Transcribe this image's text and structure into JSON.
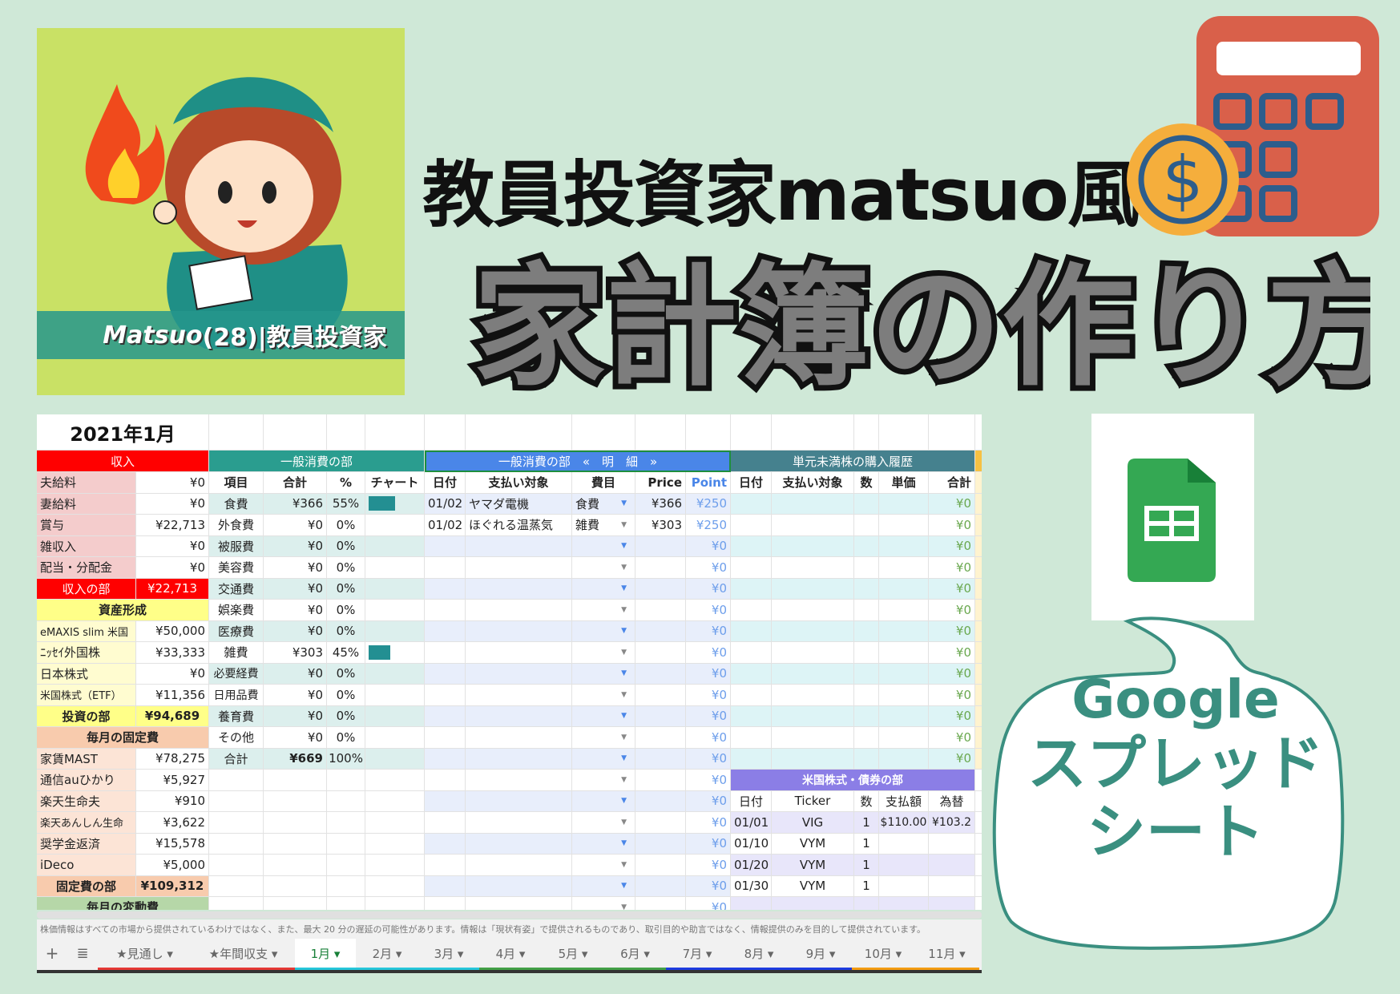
{
  "avatar": {
    "name_latin": "Matsuo",
    "name_rest": "(28)|教員投資家"
  },
  "title_line1": "教員投資家matsuo風",
  "title_line2": "家計簿の作り方",
  "bubble": {
    "line1": "Google",
    "line2": "スプレッド",
    "line3": "シート"
  },
  "icons": {
    "calculator": "calculator-icon",
    "coin": "dollar-coin-icon",
    "sheets": "google-sheets-icon",
    "flame": "flame-icon"
  },
  "colors": {
    "background": "#cfe8d7",
    "income": "#ff0000",
    "general": "#2a9d8f",
    "detail": "#4a86e8",
    "oddlot": "#45818e",
    "us": "#8b7ee6",
    "bubble_text": "#3a8f80"
  },
  "sheet": {
    "month_title": "2021年1月",
    "headers": {
      "income": "収入",
      "general": "一般消費の部",
      "detail": "一般消費の部　«　明　細　»",
      "oddlot": "単元未満株の購入履歴"
    },
    "left_rows": [
      {
        "label": "夫給料",
        "value": "¥0",
        "kind": "income"
      },
      {
        "label": "妻給料",
        "value": "¥0",
        "kind": "income"
      },
      {
        "label": "賞与",
        "value": "¥22,713",
        "kind": "income"
      },
      {
        "label": "雑収入",
        "value": "¥0",
        "kind": "income"
      },
      {
        "label": "配当・分配金",
        "value": "¥0",
        "kind": "income"
      },
      {
        "label": "収入の部",
        "value": "¥22,713",
        "kind": "income_total"
      },
      {
        "label": "資産形成",
        "kind": "asset_section"
      },
      {
        "label": "eMAXIS slim 米国",
        "value": "¥50,000",
        "kind": "asset"
      },
      {
        "label": "ﾆｯｾｲ外国株",
        "value": "¥33,333",
        "kind": "asset"
      },
      {
        "label": "日本株式",
        "value": "¥0",
        "kind": "asset"
      },
      {
        "label": "米国株式（ETF）",
        "value": "¥11,356",
        "kind": "asset"
      },
      {
        "label": "投資の部",
        "value": "¥94,689",
        "kind": "asset_total"
      },
      {
        "label": "毎月の固定費",
        "kind": "fixed_section"
      },
      {
        "label": "家賃MAST",
        "value": "¥78,275",
        "kind": "fixed"
      },
      {
        "label": "通信auひかり",
        "value": "¥5,927",
        "kind": "fixed"
      },
      {
        "label": "楽天生命夫",
        "value": "¥910",
        "kind": "fixed"
      },
      {
        "label": "楽天あんしん生命",
        "value": "¥3,622",
        "kind": "fixed"
      },
      {
        "label": "奨学金返済",
        "value": "¥15,578",
        "kind": "fixed"
      },
      {
        "label": "iDeco",
        "value": "¥5,000",
        "kind": "fixed"
      },
      {
        "label": "固定費の部",
        "value": "¥109,312",
        "kind": "fixed_total"
      },
      {
        "label": "毎月の変動費",
        "kind": "variable_section"
      }
    ],
    "general": {
      "columns": [
        "項目",
        "合計",
        "%",
        "チャート"
      ],
      "items": [
        {
          "name": "食費",
          "total": "¥366",
          "pct": "55%",
          "share": 55
        },
        {
          "name": "外食費",
          "total": "¥0",
          "pct": "0%",
          "share": 0
        },
        {
          "name": "被服費",
          "total": "¥0",
          "pct": "0%",
          "share": 0
        },
        {
          "name": "美容費",
          "total": "¥0",
          "pct": "0%",
          "share": 0
        },
        {
          "name": "交通費",
          "total": "¥0",
          "pct": "0%",
          "share": 0
        },
        {
          "name": "娯楽費",
          "total": "¥0",
          "pct": "0%",
          "share": 0
        },
        {
          "name": "医療費",
          "total": "¥0",
          "pct": "0%",
          "share": 0
        },
        {
          "name": "雑費",
          "total": "¥303",
          "pct": "45%",
          "share": 45
        },
        {
          "name": "必要経費",
          "total": "¥0",
          "pct": "0%",
          "share": 0
        },
        {
          "name": "日用品費",
          "total": "¥0",
          "pct": "0%",
          "share": 0
        },
        {
          "name": "養育費",
          "total": "¥0",
          "pct": "0%",
          "share": 0
        },
        {
          "name": "その他",
          "total": "¥0",
          "pct": "0%",
          "share": 0
        }
      ],
      "total": {
        "name": "合計",
        "total": "¥669",
        "pct": "100%"
      }
    },
    "detail": {
      "columns": [
        "日付",
        "支払い対象",
        "費目",
        "Price",
        "Point"
      ],
      "rows": [
        {
          "date": "01/02",
          "payee": "ヤマダ電機",
          "category": "食費",
          "price": "¥366",
          "point": "¥250"
        },
        {
          "date": "01/02",
          "payee": "ほぐれる温蒸気",
          "category": "雑費",
          "price": "¥303",
          "point": "¥250"
        }
      ],
      "empty_point": "¥0"
    },
    "oddlot": {
      "columns": [
        "日付",
        "支払い対象",
        "数",
        "単価",
        "合計"
      ],
      "empty_total": "¥0"
    },
    "us": {
      "title": "米国株式・債券の部",
      "columns": [
        "日付",
        "Ticker",
        "数",
        "支払額",
        "為替"
      ],
      "rows": [
        {
          "date": "01/01",
          "ticker": "VIG",
          "qty": "1",
          "paid": "$110.00",
          "fx": "¥103.2"
        },
        {
          "date": "01/10",
          "ticker": "VYM",
          "qty": "1",
          "paid": "",
          "fx": ""
        },
        {
          "date": "01/20",
          "ticker": "VYM",
          "qty": "1",
          "paid": "",
          "fx": ""
        },
        {
          "date": "01/30",
          "ticker": "VYM",
          "qty": "1",
          "paid": "",
          "fx": ""
        }
      ]
    },
    "disclaimer": "株価情報はすべての市場から提供されているわけではなく、また、最大 20 分の遅延の可能性があります。情報は「現状有姿」で提供されるものであり、取引目的や助言ではなく、情報提供のみを目的して提供されています。",
    "add_sheet": "+",
    "all_sheets": "≣",
    "tabs": [
      {
        "label": "★見通し ▾",
        "color": "#e53935"
      },
      {
        "label": "★年間収支 ▾",
        "color": "#e53935"
      },
      {
        "label": "1月 ▾",
        "color": "#26c6da",
        "active": true
      },
      {
        "label": "2月 ▾",
        "color": "#26c6da"
      },
      {
        "label": "3月 ▾",
        "color": "#26c6da"
      },
      {
        "label": "4月 ▾",
        "color": "#43a047"
      },
      {
        "label": "5月 ▾",
        "color": "#43a047"
      },
      {
        "label": "6月 ▾",
        "color": "#43a047"
      },
      {
        "label": "7月 ▾",
        "color": "#1e3ce0"
      },
      {
        "label": "8月 ▾",
        "color": "#1e3ce0"
      },
      {
        "label": "9月 ▾",
        "color": "#1e3ce0"
      },
      {
        "label": "10月 ▾",
        "color": "#f39c12"
      },
      {
        "label": "11月 ▾",
        "color": "#f39c12"
      }
    ]
  }
}
